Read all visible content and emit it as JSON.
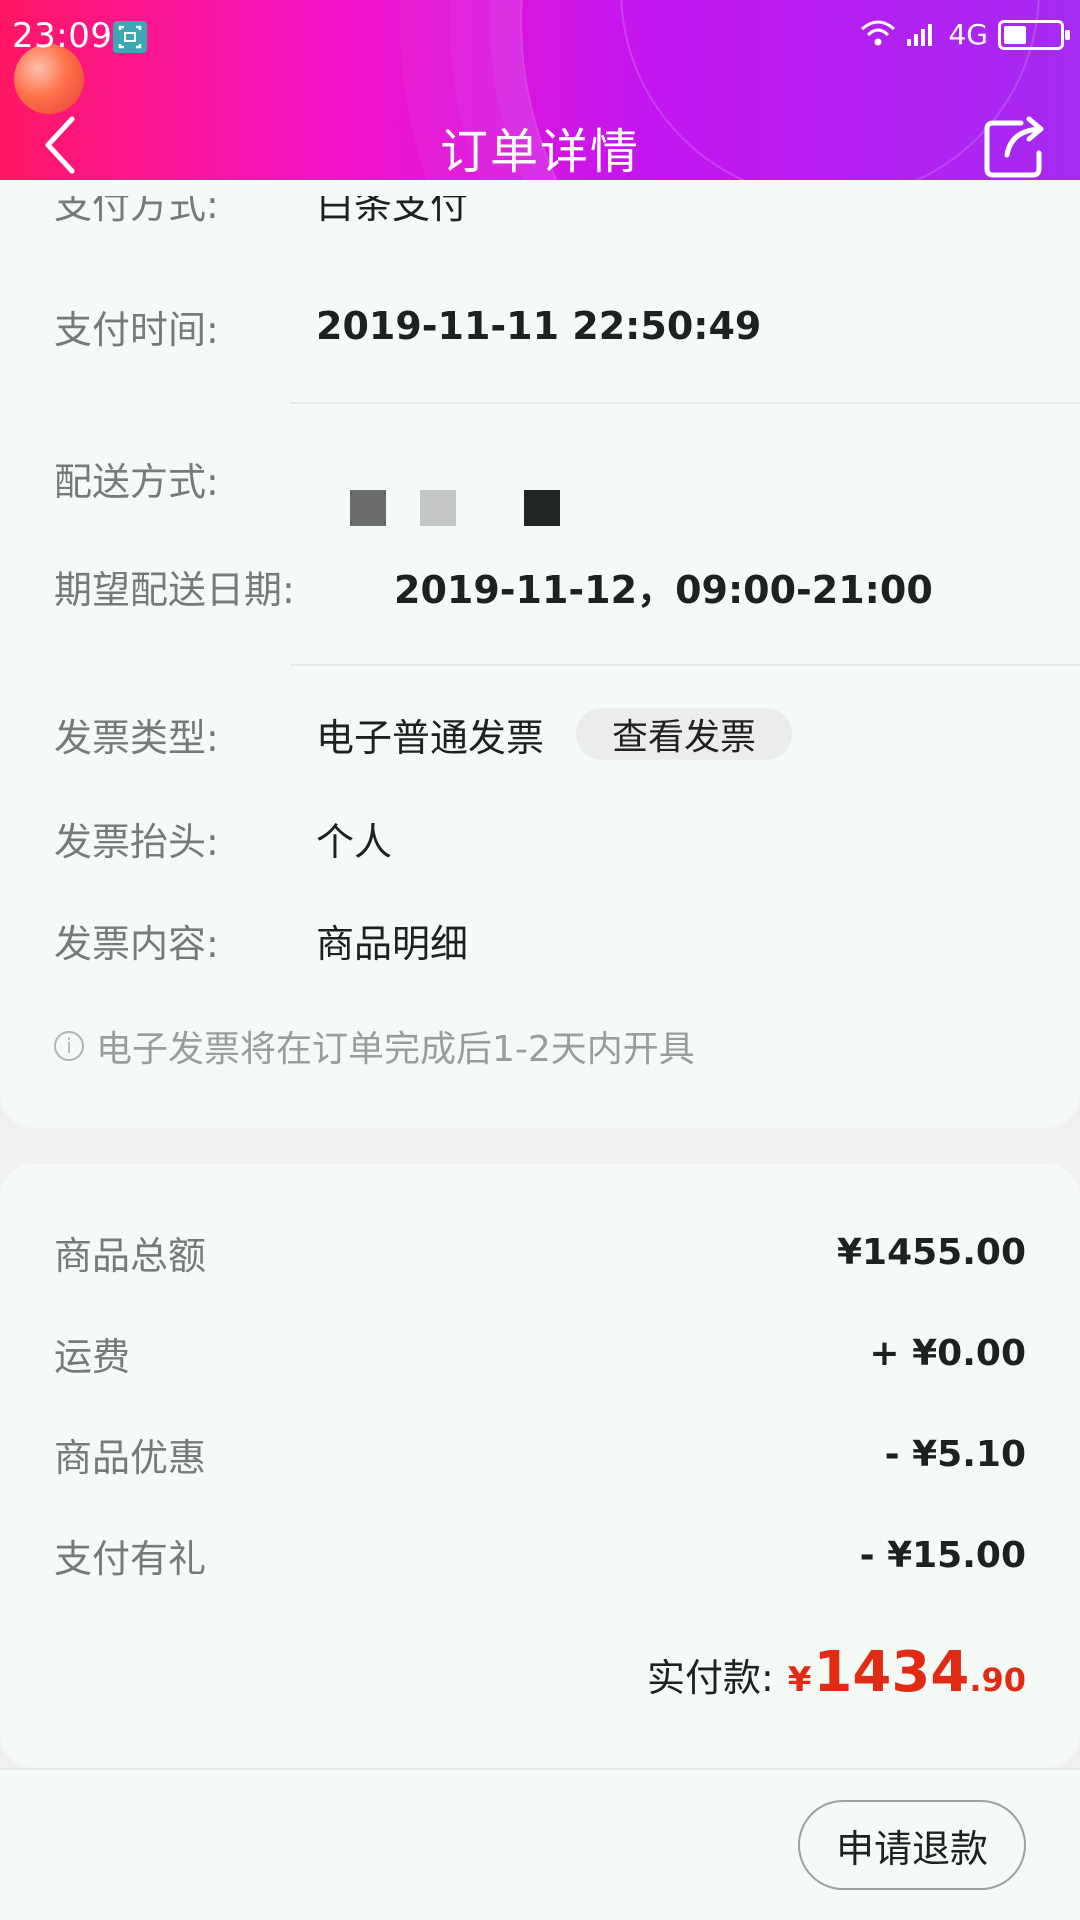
{
  "status_bar": {
    "time": "23:09",
    "network": "4G",
    "battery_level": 0.4
  },
  "header": {
    "title": "订单详情",
    "back_icon": "chevron-left-icon",
    "share_icon": "share-icon"
  },
  "order_info": {
    "payment_method_label": "支付方式:",
    "payment_method_value": "白条支付",
    "payment_time_label": "支付时间:",
    "payment_time_value": "2019-11-11 22:50:49",
    "delivery_method_label": "配送方式:",
    "delivery_colors": [
      "#6a6c6a",
      "#c5c7c5",
      "#222622"
    ],
    "expected_date_label": "期望配送日期:",
    "expected_date_value": "2019-11-12，09:00-21:00",
    "invoice_type_label": "发票类型:",
    "invoice_type_value": "电子普通发票",
    "view_invoice_button": "查看发票",
    "invoice_title_label": "发票抬头:",
    "invoice_title_value": "个人",
    "invoice_content_label": "发票内容:",
    "invoice_content_value": "商品明细",
    "invoice_tip": "电子发票将在订单完成后1-2天内开具"
  },
  "amounts": {
    "goods_total_label": "商品总额",
    "goods_total_value": "¥1455.00",
    "shipping_label": "运费",
    "shipping_value": "+ ¥0.00",
    "goods_discount_label": "商品优惠",
    "goods_discount_value": "- ¥5.10",
    "pay_gift_label": "支付有礼",
    "pay_gift_value": "- ¥15.00",
    "paid_label": "实付款:",
    "paid_symbol": "¥",
    "paid_integer": "1434",
    "paid_decimal": ".90"
  },
  "bottom": {
    "refund_button": "申请退款"
  },
  "colors": {
    "accent_red": "#e22b15",
    "header_gradient_start": "#ff1763",
    "header_gradient_end": "#a52af2"
  }
}
